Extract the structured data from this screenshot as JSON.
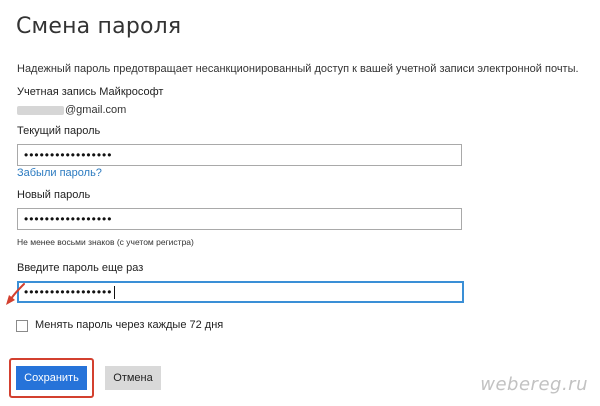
{
  "page": {
    "title": "Смена пароля",
    "intro": "Надежный пароль предотвращает несанкционированный доступ к вашей учетной записи электронной почты."
  },
  "account": {
    "label": "Учетная запись Майкрософт",
    "email_suffix": "@gmail.com"
  },
  "form": {
    "current_password": {
      "label": "Текущий пароль",
      "value": "•••••••••••••••••"
    },
    "forgot_link": "Забыли пароль?",
    "new_password": {
      "label": "Новый пароль",
      "value": "•••••••••••••••••",
      "hint": "Не менее восьми знаков (с учетом регистра)"
    },
    "confirm_password": {
      "label": "Введите пароль еще раз",
      "value": "•••••••••••••••••"
    },
    "change_every_72_days": {
      "label": "Менять пароль через каждые 72 дня",
      "checked": false
    }
  },
  "buttons": {
    "save": "Сохранить",
    "cancel": "Отмена"
  },
  "watermark": "webereg.ru",
  "colors": {
    "accent": "#2673d9",
    "link": "#2a7ac0",
    "focus": "#3a8fd6",
    "annotation": "#d3402f"
  },
  "icons": {
    "annotation_arrow": "red-arrow-icon"
  }
}
